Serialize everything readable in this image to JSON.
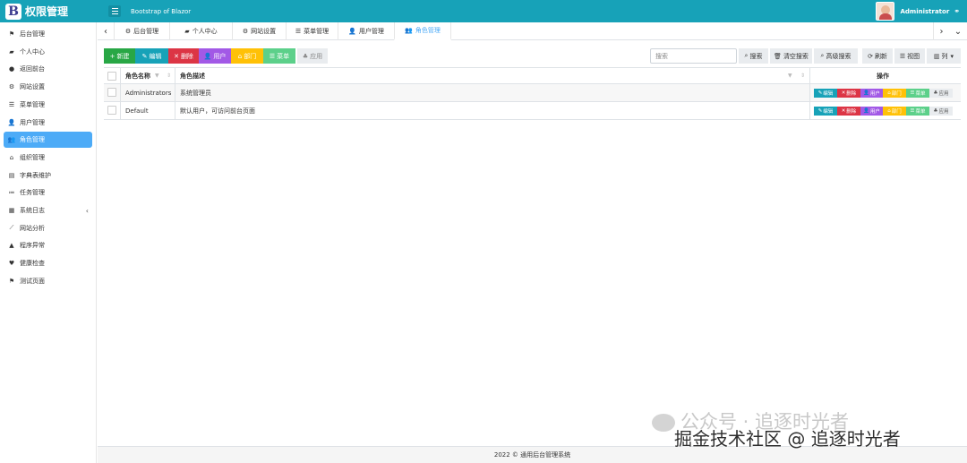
{
  "header": {
    "brand_letter": "B",
    "brand_title": "权限管理",
    "app_title": "Bootstrap of Blazor",
    "username": "Administrator"
  },
  "sidebar": {
    "items": [
      {
        "label": "后台管理",
        "icon": "flag-icon",
        "glyph": "⚑"
      },
      {
        "label": "个人中心",
        "icon": "briefcase-icon",
        "glyph": "▰"
      },
      {
        "label": "返回前台",
        "icon": "circle-icon",
        "glyph": "●"
      },
      {
        "label": "网站设置",
        "icon": "gear-icon",
        "glyph": "⚙"
      },
      {
        "label": "菜单管理",
        "icon": "list-icon",
        "glyph": "☰"
      },
      {
        "label": "用户管理",
        "icon": "user-add-icon",
        "glyph": "👤"
      },
      {
        "label": "角色管理",
        "icon": "users-icon",
        "glyph": "👥",
        "active": true
      },
      {
        "label": "组织管理",
        "icon": "bank-icon",
        "glyph": "⌂"
      },
      {
        "label": "字典表维护",
        "icon": "book-icon",
        "glyph": "▤"
      },
      {
        "label": "任务管理",
        "icon": "tasks-icon",
        "glyph": "≔"
      },
      {
        "label": "系统日志",
        "icon": "log-icon",
        "glyph": "▦",
        "caret": "‹"
      },
      {
        "label": "网站分析",
        "icon": "chart-icon",
        "glyph": "⟋"
      },
      {
        "label": "程序异常",
        "icon": "warning-icon",
        "glyph": "▲"
      },
      {
        "label": "健康检查",
        "icon": "heartbeat-icon",
        "glyph": "♥"
      },
      {
        "label": "测试页面",
        "icon": "flag-icon",
        "glyph": "⚑"
      }
    ]
  },
  "tabs": [
    {
      "label": "后台管理",
      "icon": "gear-icon",
      "glyph": "⚙"
    },
    {
      "label": "个人中心",
      "icon": "briefcase-icon",
      "glyph": "▰"
    },
    {
      "label": "网站设置",
      "icon": "gear-icon",
      "glyph": "⚙"
    },
    {
      "label": "菜单管理",
      "icon": "list-icon",
      "glyph": "☰"
    },
    {
      "label": "用户管理",
      "icon": "user-add-icon",
      "glyph": "👤"
    },
    {
      "label": "角色管理",
      "icon": "users-icon",
      "glyph": "👥",
      "active": true
    }
  ],
  "toolbar": {
    "buttons": [
      {
        "label": "新建",
        "icon": "plus-icon",
        "glyph": "+",
        "color": "#28a745"
      },
      {
        "label": "编辑",
        "icon": "edit-icon",
        "glyph": "✎",
        "color": "#17a2b8"
      },
      {
        "label": "删除",
        "icon": "times-icon",
        "glyph": "✕",
        "color": "#dc3545"
      },
      {
        "label": "用户",
        "icon": "user-icon",
        "glyph": "👤",
        "color": "#a259e6"
      },
      {
        "label": "部门",
        "icon": "building-icon",
        "glyph": "⌂",
        "color": "#ffc107"
      },
      {
        "label": "菜单",
        "icon": "list-icon",
        "glyph": "☰",
        "color": "#5cd08a"
      },
      {
        "label": "应用",
        "icon": "cubes-icon",
        "glyph": "♣",
        "color": "#e9ecef"
      }
    ],
    "search_placeholder": "搜索",
    "search_label": "搜索",
    "clear_search_label": "清空搜索",
    "advanced_search_label": "高级搜索",
    "refresh_label": "刷新",
    "view_label": "视图",
    "columns_label": "列"
  },
  "table": {
    "columns": [
      "角色名称",
      "角色描述",
      "操作"
    ],
    "rows": [
      {
        "name": "Administrators",
        "description": "系统管理员"
      },
      {
        "name": "Default",
        "description": "默认用户，可访问前台页面"
      }
    ],
    "row_actions": [
      {
        "label": "编辑",
        "glyph": "✎",
        "color": "#17a2b8"
      },
      {
        "label": "删除",
        "glyph": "✕",
        "color": "#dc3545"
      },
      {
        "label": "用户",
        "glyph": "👤",
        "color": "#a259e6"
      },
      {
        "label": "部门",
        "glyph": "⌂",
        "color": "#ffc107"
      },
      {
        "label": "菜单",
        "glyph": "☰",
        "color": "#5cd08a"
      },
      {
        "label": "应用",
        "glyph": "♣",
        "color": "#e9ecef"
      }
    ]
  },
  "footer": {
    "text": "2022 © 通用后台管理系统"
  },
  "watermark": {
    "line1": "公众号 · 追逐时光者",
    "line2": "掘金技术社区 @ 追逐时光者"
  }
}
